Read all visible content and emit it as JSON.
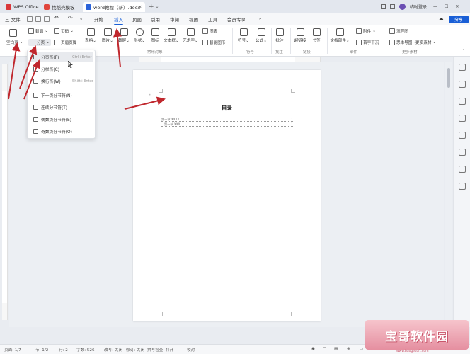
{
  "titlebar": {
    "tabs": [
      {
        "label": "WPS Office",
        "color": "#d9373a"
      },
      {
        "label": "找稻壳模板",
        "color": "#e0453c"
      },
      {
        "label": "word教程（新）.docx",
        "color": "#2b63d9"
      }
    ],
    "user": "临时登录"
  },
  "menubar": {
    "file_label": "三 文件",
    "items": [
      "开始",
      "插入",
      "页面",
      "引用",
      "审阅",
      "视图",
      "工具",
      "会员专享"
    ],
    "active_index": 1,
    "share": "分享"
  },
  "ribbon": {
    "row1": [
      {
        "label": "封面"
      },
      {
        "label": "页码"
      },
      {
        "label": "图表"
      },
      {
        "label": "附件"
      },
      {
        "label": "流程图"
      }
    ],
    "row2": [
      {
        "label": "空白页"
      },
      {
        "label": "分页"
      },
      {
        "label": "页眉页脚"
      },
      {
        "label": "思维导图"
      },
      {
        "label": "更多素材"
      }
    ],
    "big": [
      {
        "label": "表格"
      },
      {
        "label": "图片"
      },
      {
        "label": "截屏"
      },
      {
        "label": "形状"
      },
      {
        "label": "图标"
      },
      {
        "label": "文本框"
      },
      {
        "label": "艺术字"
      },
      {
        "label": "智能图形"
      },
      {
        "label": "符号"
      },
      {
        "label": "公式"
      },
      {
        "label": "批注"
      },
      {
        "label": "超链接"
      },
      {
        "label": "书签"
      },
      {
        "label": "文档部件"
      },
      {
        "label": "首字下沉"
      }
    ],
    "groups": [
      "常用对象",
      "符号",
      "批注",
      "链接",
      "部件",
      "更多素材"
    ]
  },
  "dropdown": {
    "items": [
      {
        "label": "分页符(P)",
        "shortcut": "Ctrl+Enter"
      },
      {
        "label": "分栏符(C)",
        "shortcut": ""
      },
      {
        "label": "换行符(W)",
        "shortcut": "Shift+Enter"
      },
      {
        "label": "下一页分节符(N)",
        "shortcut": ""
      },
      {
        "label": "连续分节符(T)",
        "shortcut": ""
      },
      {
        "label": "偶数页分节符(E)",
        "shortcut": ""
      },
      {
        "label": "奇数页分节符(O)",
        "shortcut": ""
      }
    ]
  },
  "document": {
    "title": "目录",
    "toc": [
      {
        "text": "第一章 XXXX",
        "page": "1"
      },
      {
        "text": "第一节 XXX",
        "page": "1"
      }
    ]
  },
  "status": {
    "page": "页面: 1/7",
    "section": "节: 1/2",
    "line": "行: 2",
    "words": "字数: 526",
    "revise": "改写: 关闭",
    "track": "修订: 关闭",
    "spell": "拼写检查: 打开",
    "proof": "校对",
    "zoom": "70%"
  },
  "watermark": {
    "text": "宝哥软件园",
    "url": "www.baogesoft.com"
  },
  "colors": {
    "accent": "#1a5fd6",
    "arrow": "#c0272d"
  }
}
